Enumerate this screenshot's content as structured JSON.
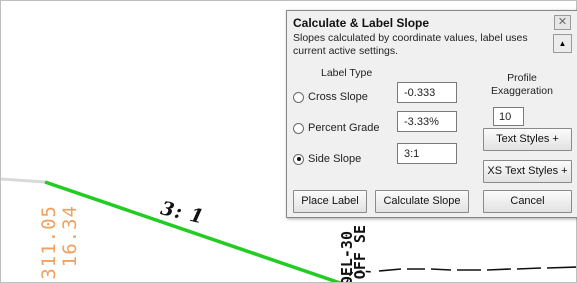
{
  "canvas": {
    "slope_label": "3: 1",
    "station_text_a": "311.05",
    "station_text_b": "16.34",
    "side_text_a": "OEL-30",
    "side_text_b": "OFF SE"
  },
  "dialog": {
    "title": "Calculate & Label Slope",
    "description": "Slopes calculated by coordinate values, label uses current active settings.",
    "close_label": "✕",
    "help_label": "▲",
    "label_type_heading": "Label Type",
    "options": [
      {
        "label": "Cross Slope",
        "value": "-0.333",
        "selected": false
      },
      {
        "label": "Percent Grade",
        "value": "-3.33%",
        "selected": false
      },
      {
        "label": "Side Slope",
        "value": "3:1",
        "selected": true
      }
    ],
    "profile_exaggeration_label": "Profile Exaggeration",
    "profile_exaggeration_value": "10",
    "buttons": {
      "text_styles": "Text Styles +",
      "xs_text_styles": "XS Text Styles +",
      "place_label": "Place Label",
      "calculate_slope": "Calculate Slope",
      "cancel": "Cancel"
    }
  },
  "colors": {
    "slope_line": "#22cc22",
    "station_text": "#f0a060",
    "dialog_bg": "#f0f0f0"
  }
}
